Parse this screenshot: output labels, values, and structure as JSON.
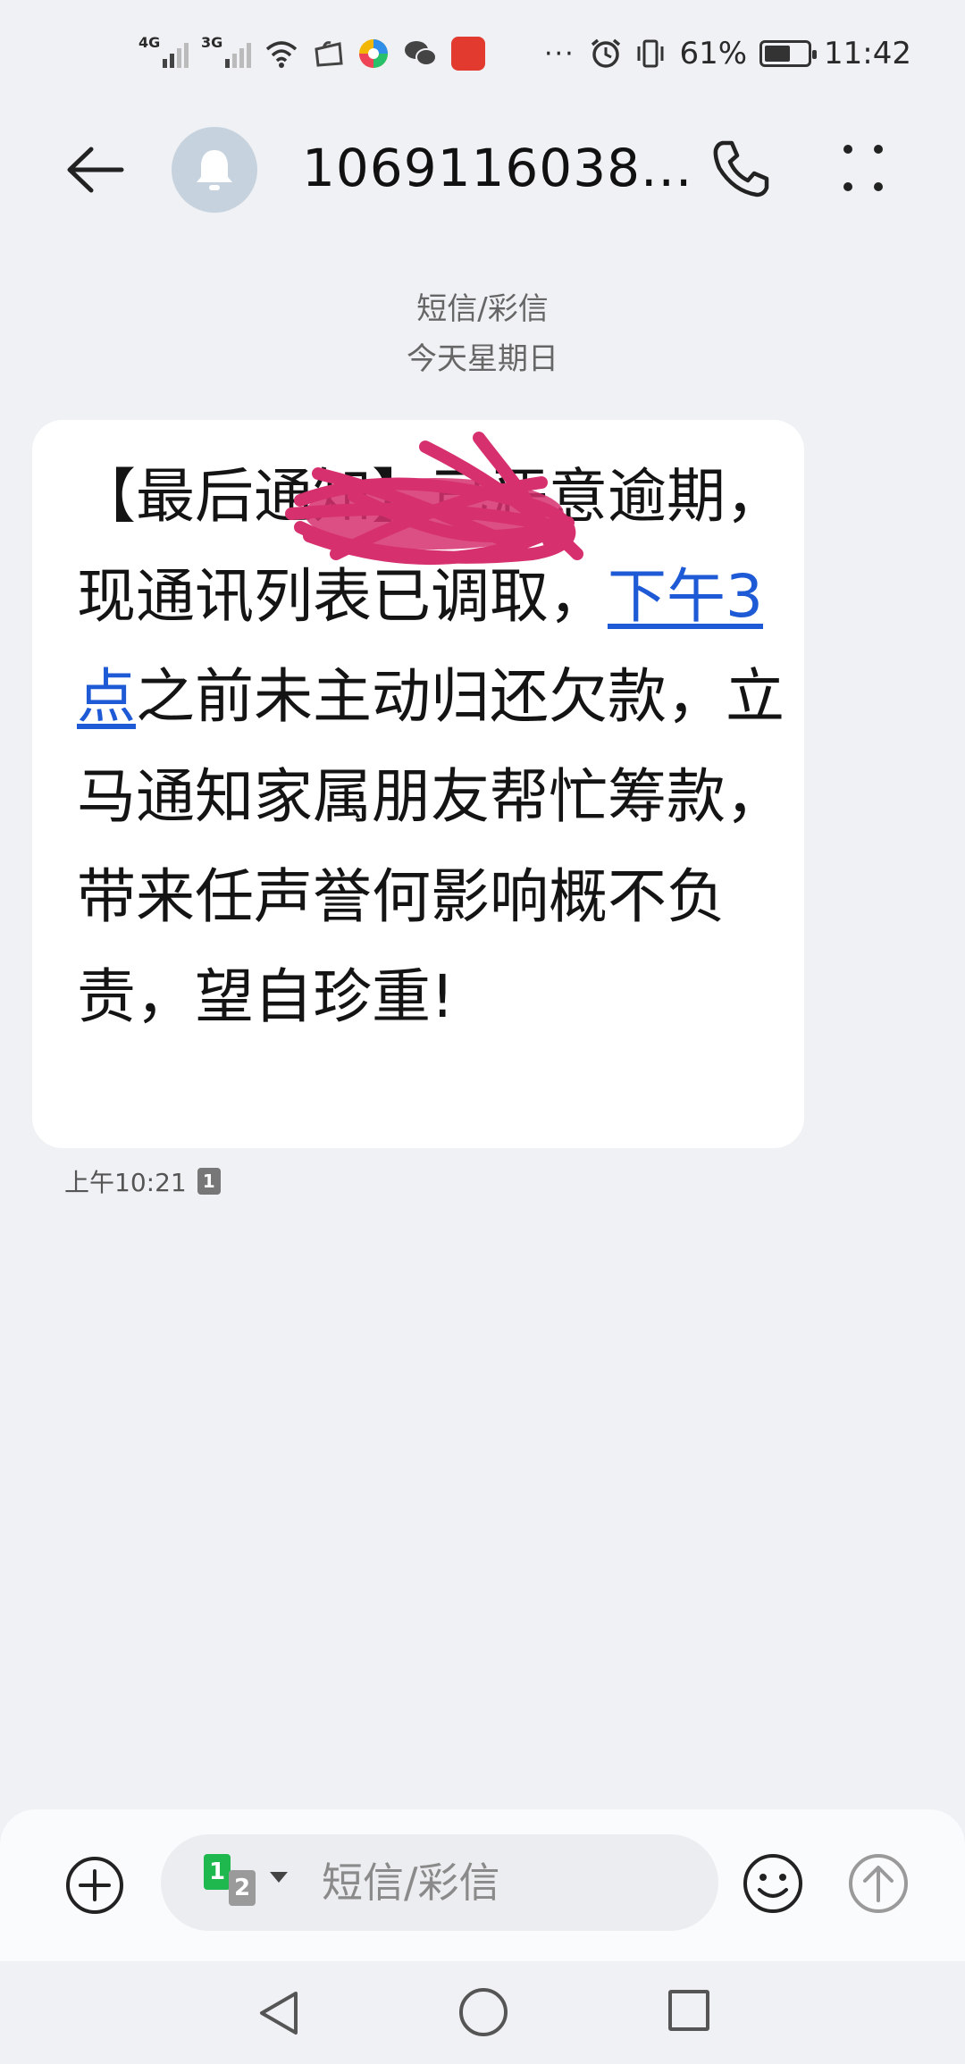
{
  "status_bar": {
    "signal1_label": "4G",
    "signal2_label": "3G",
    "more_dots": "···",
    "battery_text": "61%",
    "battery_level": 0.61,
    "time": "11:42"
  },
  "header": {
    "contact_number": "1069116038..."
  },
  "conversation": {
    "type_label": "短信/彩信",
    "date_label": "今天星期日"
  },
  "message": {
    "text_part1": "【最后通知】",
    "text_part2": "已恶意逾期，现通讯列表已调取，",
    "link_text": "下午3点",
    "text_part3": "之前未主动归还欠款，立马通知家属朋友帮忙筹款，带来任声誉何影响概不负责，望自珍重!",
    "time": "上午10:21",
    "sim_tag": "1"
  },
  "composer": {
    "sim1": "1",
    "sim2": "2",
    "placeholder": "短信/彩信"
  },
  "colors": {
    "link": "#1e5ad6",
    "scribble": "#d6306e",
    "background": "#eff1f4"
  }
}
